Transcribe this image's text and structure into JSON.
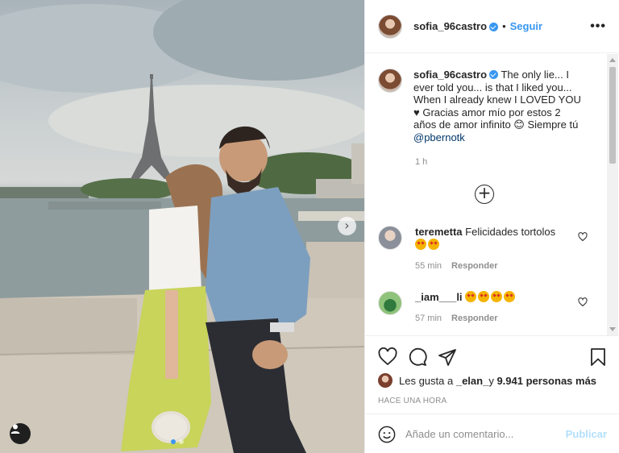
{
  "post": {
    "username": "sofia_96castro",
    "separator": "•",
    "follow_label": "Seguir",
    "more_label": "•••"
  },
  "caption": {
    "username": "sofia_96castro",
    "text": " The only lie... I ever told you... is that I liked you... When I already knew I LOVED YOU ♥ Gracias amor mío por estos 2 años de amor infinito 😊 Siempre tú ",
    "mention": "@pbernotk",
    "time": "1 h"
  },
  "comments": [
    {
      "username": "teremetta",
      "text": " Felicidades tortolos",
      "emoji_count": 2,
      "time": "55 min",
      "reply_label": "Responder",
      "avatar_color": "#9fa7b3"
    },
    {
      "username": "_iam___li",
      "text": " ",
      "emoji_count": 4,
      "time": "57 min",
      "reply_label": "Responder",
      "avatar_color": "#4f8f5a"
    }
  ],
  "likes": {
    "prefix": "Les gusta a ",
    "user": "_elan_",
    "middle": " y ",
    "count": "9.941 personas más"
  },
  "posted_ago": "HACE UNA HORA",
  "composer": {
    "placeholder": "Añade un comentario...",
    "publish_label": "Publicar"
  },
  "carousel": {
    "next_glyph": "›",
    "current_slide": 1,
    "total_slides": 2
  },
  "colors": {
    "accent": "#3897f0",
    "text": "#262626",
    "muted": "#8e8e8e",
    "publish_disabled": "#b2dffc"
  },
  "icons": [
    "heart-icon",
    "comment-icon",
    "share-icon",
    "bookmark-icon",
    "emoji-icon",
    "plus-circle-icon",
    "user-tag-icon",
    "verified-icon"
  ]
}
